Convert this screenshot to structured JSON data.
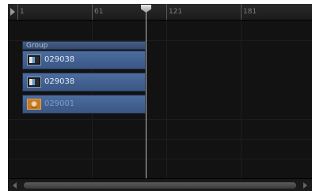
{
  "ruler": {
    "labels": [
      "1",
      "61",
      "121",
      "181"
    ]
  },
  "group": {
    "label": "Group"
  },
  "clips": [
    {
      "label": "029038",
      "icon": "video-clip-icon"
    },
    {
      "label": "029038",
      "icon": "video-clip-icon"
    },
    {
      "label": "029001",
      "icon": "still-image-icon"
    }
  ]
}
